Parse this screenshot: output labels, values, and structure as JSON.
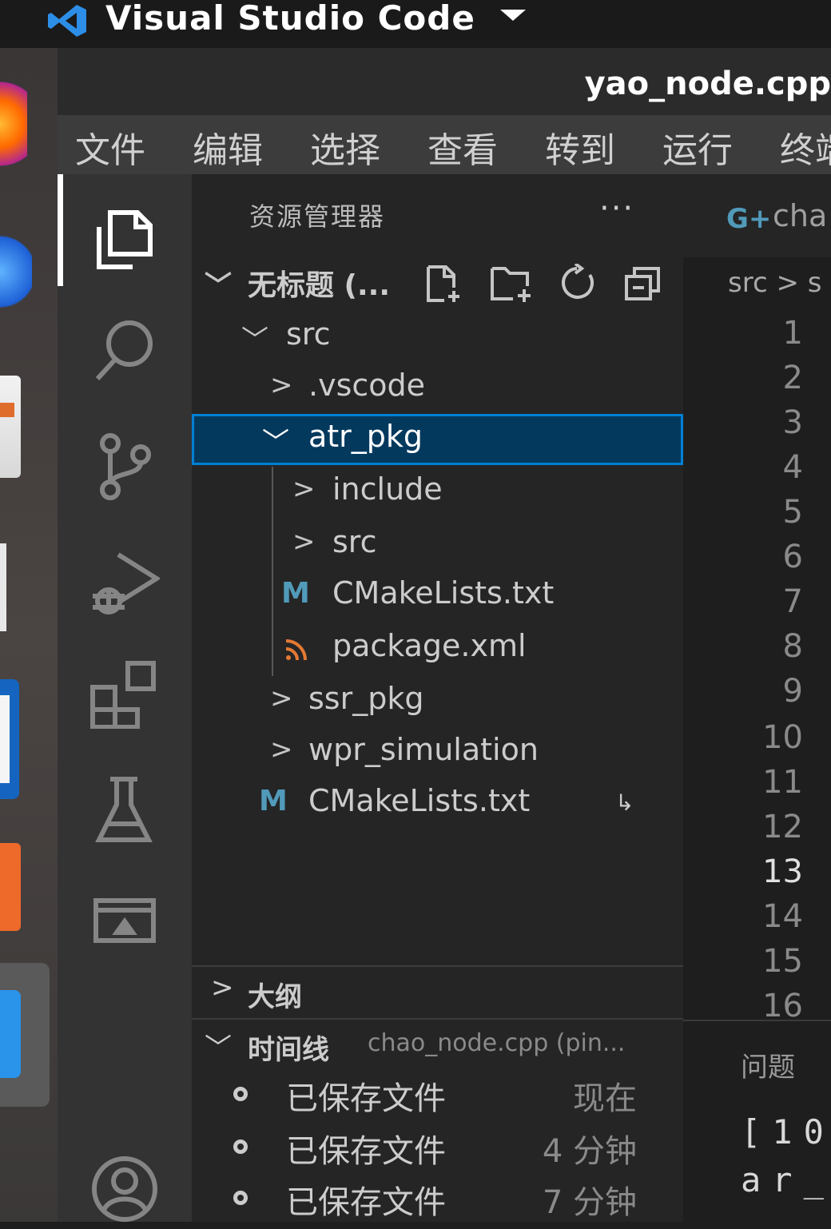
{
  "topbar": {
    "app_name": "Visual Studio Code"
  },
  "window": {
    "title": "yao_node.cpp"
  },
  "menu": [
    "文件",
    "编辑",
    "选择",
    "查看",
    "转到",
    "运行",
    "终端"
  ],
  "activity_bar": {
    "items": [
      "explorer",
      "search",
      "source-control",
      "run-debug",
      "extensions",
      "testing",
      "remote-explorer"
    ],
    "bottom": "accounts"
  },
  "sidebar": {
    "title": "资源管理器",
    "more": "···",
    "workspace": "无标题 (...",
    "tree": [
      {
        "label": "src",
        "expanded": true
      },
      {
        "label": ".vscode",
        "expanded": false
      },
      {
        "label": "atr_pkg",
        "expanded": true
      },
      {
        "label": "include",
        "expanded": false
      },
      {
        "label": "src",
        "expanded": false
      },
      {
        "label": "CMakeLists.txt",
        "icon": "M"
      },
      {
        "label": "package.xml",
        "icon": "rss"
      },
      {
        "label": "ssr_pkg",
        "expanded": false
      },
      {
        "label": "wpr_simulation",
        "expanded": false
      },
      {
        "label": "CMakeLists.txt",
        "icon": "M",
        "badge": "↳"
      }
    ],
    "outline": {
      "label": "大纲"
    },
    "timeline": {
      "label": "时间线",
      "file": "chao_node.cpp (pin...",
      "entries": [
        {
          "label": "已保存文件",
          "time": "现在"
        },
        {
          "label": "已保存文件",
          "time": "4 分钟"
        },
        {
          "label": "已保存文件",
          "time": "7 分钟"
        }
      ]
    }
  },
  "editor": {
    "tab_label": "cha",
    "breadcrumb": "src > s",
    "line_numbers": [
      "1",
      "2",
      "3",
      "4",
      "5",
      "6",
      "7",
      "8",
      "9",
      "10",
      "11",
      "12",
      "13",
      "14",
      "15",
      "16"
    ],
    "current_line": "13"
  },
  "panel": {
    "tab": "问题",
    "lines": [
      "[10",
      "ar_"
    ]
  },
  "colors": {
    "accent": "#007fd4",
    "selection": "#04395e",
    "cmake_icon": "#519aba",
    "rss_icon": "#e37933"
  }
}
